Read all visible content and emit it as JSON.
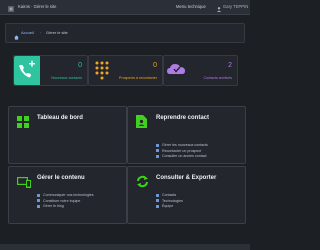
{
  "topbar": {
    "brand": "Kairos · Gérer le site",
    "menu": "Menu technique",
    "user": "Gary TEPPIN"
  },
  "breadcrumb": {
    "home": "Accueil",
    "separator": "›",
    "current": "Gérer le site"
  },
  "stats": [
    {
      "value": "0",
      "label": "Nouveaux contacts",
      "color": "#2ec4a0",
      "icon": "phone-add-icon"
    },
    {
      "value": "0",
      "label": "Prospects à recontacter",
      "color": "#f0a528",
      "icon": "dialpad-icon"
    },
    {
      "value": "2",
      "label": "Contacts archivés",
      "color": "#b07be6",
      "icon": "cloud-download-icon"
    }
  ],
  "cards": {
    "dashboard": {
      "title": "Tableau de bord",
      "icon": "grid-icon",
      "items": []
    },
    "contact": {
      "title": "Reprendre contact",
      "icon": "contact-file-icon",
      "items": [
        "Gérer les nouveaux contacts",
        "Recontacter un prospect",
        "Consulter un ancien contact"
      ]
    },
    "content": {
      "title": "Gérer le contenu",
      "icon": "devices-icon",
      "items": [
        "Communiquer nos technologies",
        "Constituer notre équipe",
        "Gérer le blog"
      ]
    },
    "export": {
      "title": "Consulter & Exporter",
      "icon": "sync-icon",
      "items": [
        "Contacts",
        "Technologies",
        "Équipe"
      ]
    }
  },
  "colors": {
    "accent_green": "#2ec4a0",
    "icon_green": "#3fd11d",
    "link_blue": "#8fb8ff"
  }
}
